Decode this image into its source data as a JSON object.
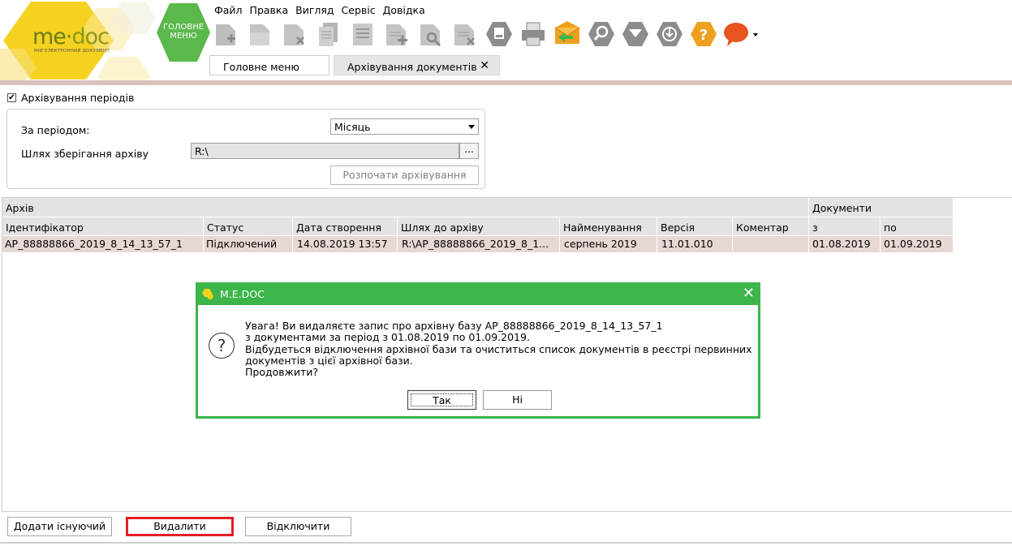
{
  "app": {
    "logo_me": "me",
    "logo_doc": "doc",
    "logo_sub": "МІЙ ЕЛЕКТРОННИЙ ДОКУМЕНТ",
    "main_menu_label_1": "ГОЛОВНЕ",
    "main_menu_label_2": "МЕНЮ"
  },
  "menubar": [
    "Файл",
    "Правка",
    "Вигляд",
    "Сервіс",
    "Довідка"
  ],
  "toolbar_icons": [
    "new-doc-icon",
    "open-doc-icon",
    "delete-doc-icon",
    "copy-doc-icon",
    "edit-doc-icon",
    "add-row-icon",
    "search-row-icon",
    "delete-row-icon",
    "archive-icon",
    "print-icon",
    "send-icon",
    "find-icon",
    "filter-icon",
    "refresh-icon",
    "help-icon",
    "chat-icon"
  ],
  "tabs": [
    {
      "label": "Головне меню"
    },
    {
      "label": "Архівування документів",
      "close": "✕"
    }
  ],
  "settings": {
    "checkbox_label": "Архівування періодів",
    "checkbox_mark": "✔",
    "period_label": "За періодом:",
    "period_value": "Місяць",
    "path_label": "Шлях зберігання архіву",
    "path_value": "R:\\",
    "path_browse": "...",
    "start_button": "Розпочати архівування"
  },
  "grid": {
    "group_archive": "Архів",
    "group_docs": "Документи",
    "columns": [
      "Ідентифікатор",
      "Статус",
      "Дата створення",
      "Шлях до архіву",
      "Найменування",
      "Версія",
      "Коментар",
      "з",
      "по"
    ],
    "rows": [
      [
        "АР_88888866_2019_8_14_13_57_1",
        "Підключений",
        "14.08.2019 13:57",
        "R:\\AP_88888866_2019_8_1...",
        "серпень 2019",
        "11.01.010",
        "",
        "01.08.2019",
        "01.09.2019"
      ]
    ]
  },
  "buttons": {
    "add": "Додати існуючий",
    "delete": "Видалити",
    "disconnect": "Відключити"
  },
  "dialog": {
    "title": "M.E.DOC",
    "close": "✕",
    "icon": "?",
    "lines": [
      "Увага! Ви видаляєте запис про архівну базу АР_88888866_2019_8_14_13_57_1",
      "з документами за період з 01.08.2019 по 01.09.2019.",
      "Відбудеться відключення архівної бази та очиститься список документів в реєстрі первинних",
      "документів з цієї архівної бази.",
      "Продовжити?"
    ],
    "yes": "Так",
    "no": "Ні"
  },
  "colors": {
    "accent_green": "#3cb54a",
    "logo_yellow": "#f5d21f",
    "highlight_red": "#e41e26",
    "selected_row": "#e8d8d4"
  }
}
